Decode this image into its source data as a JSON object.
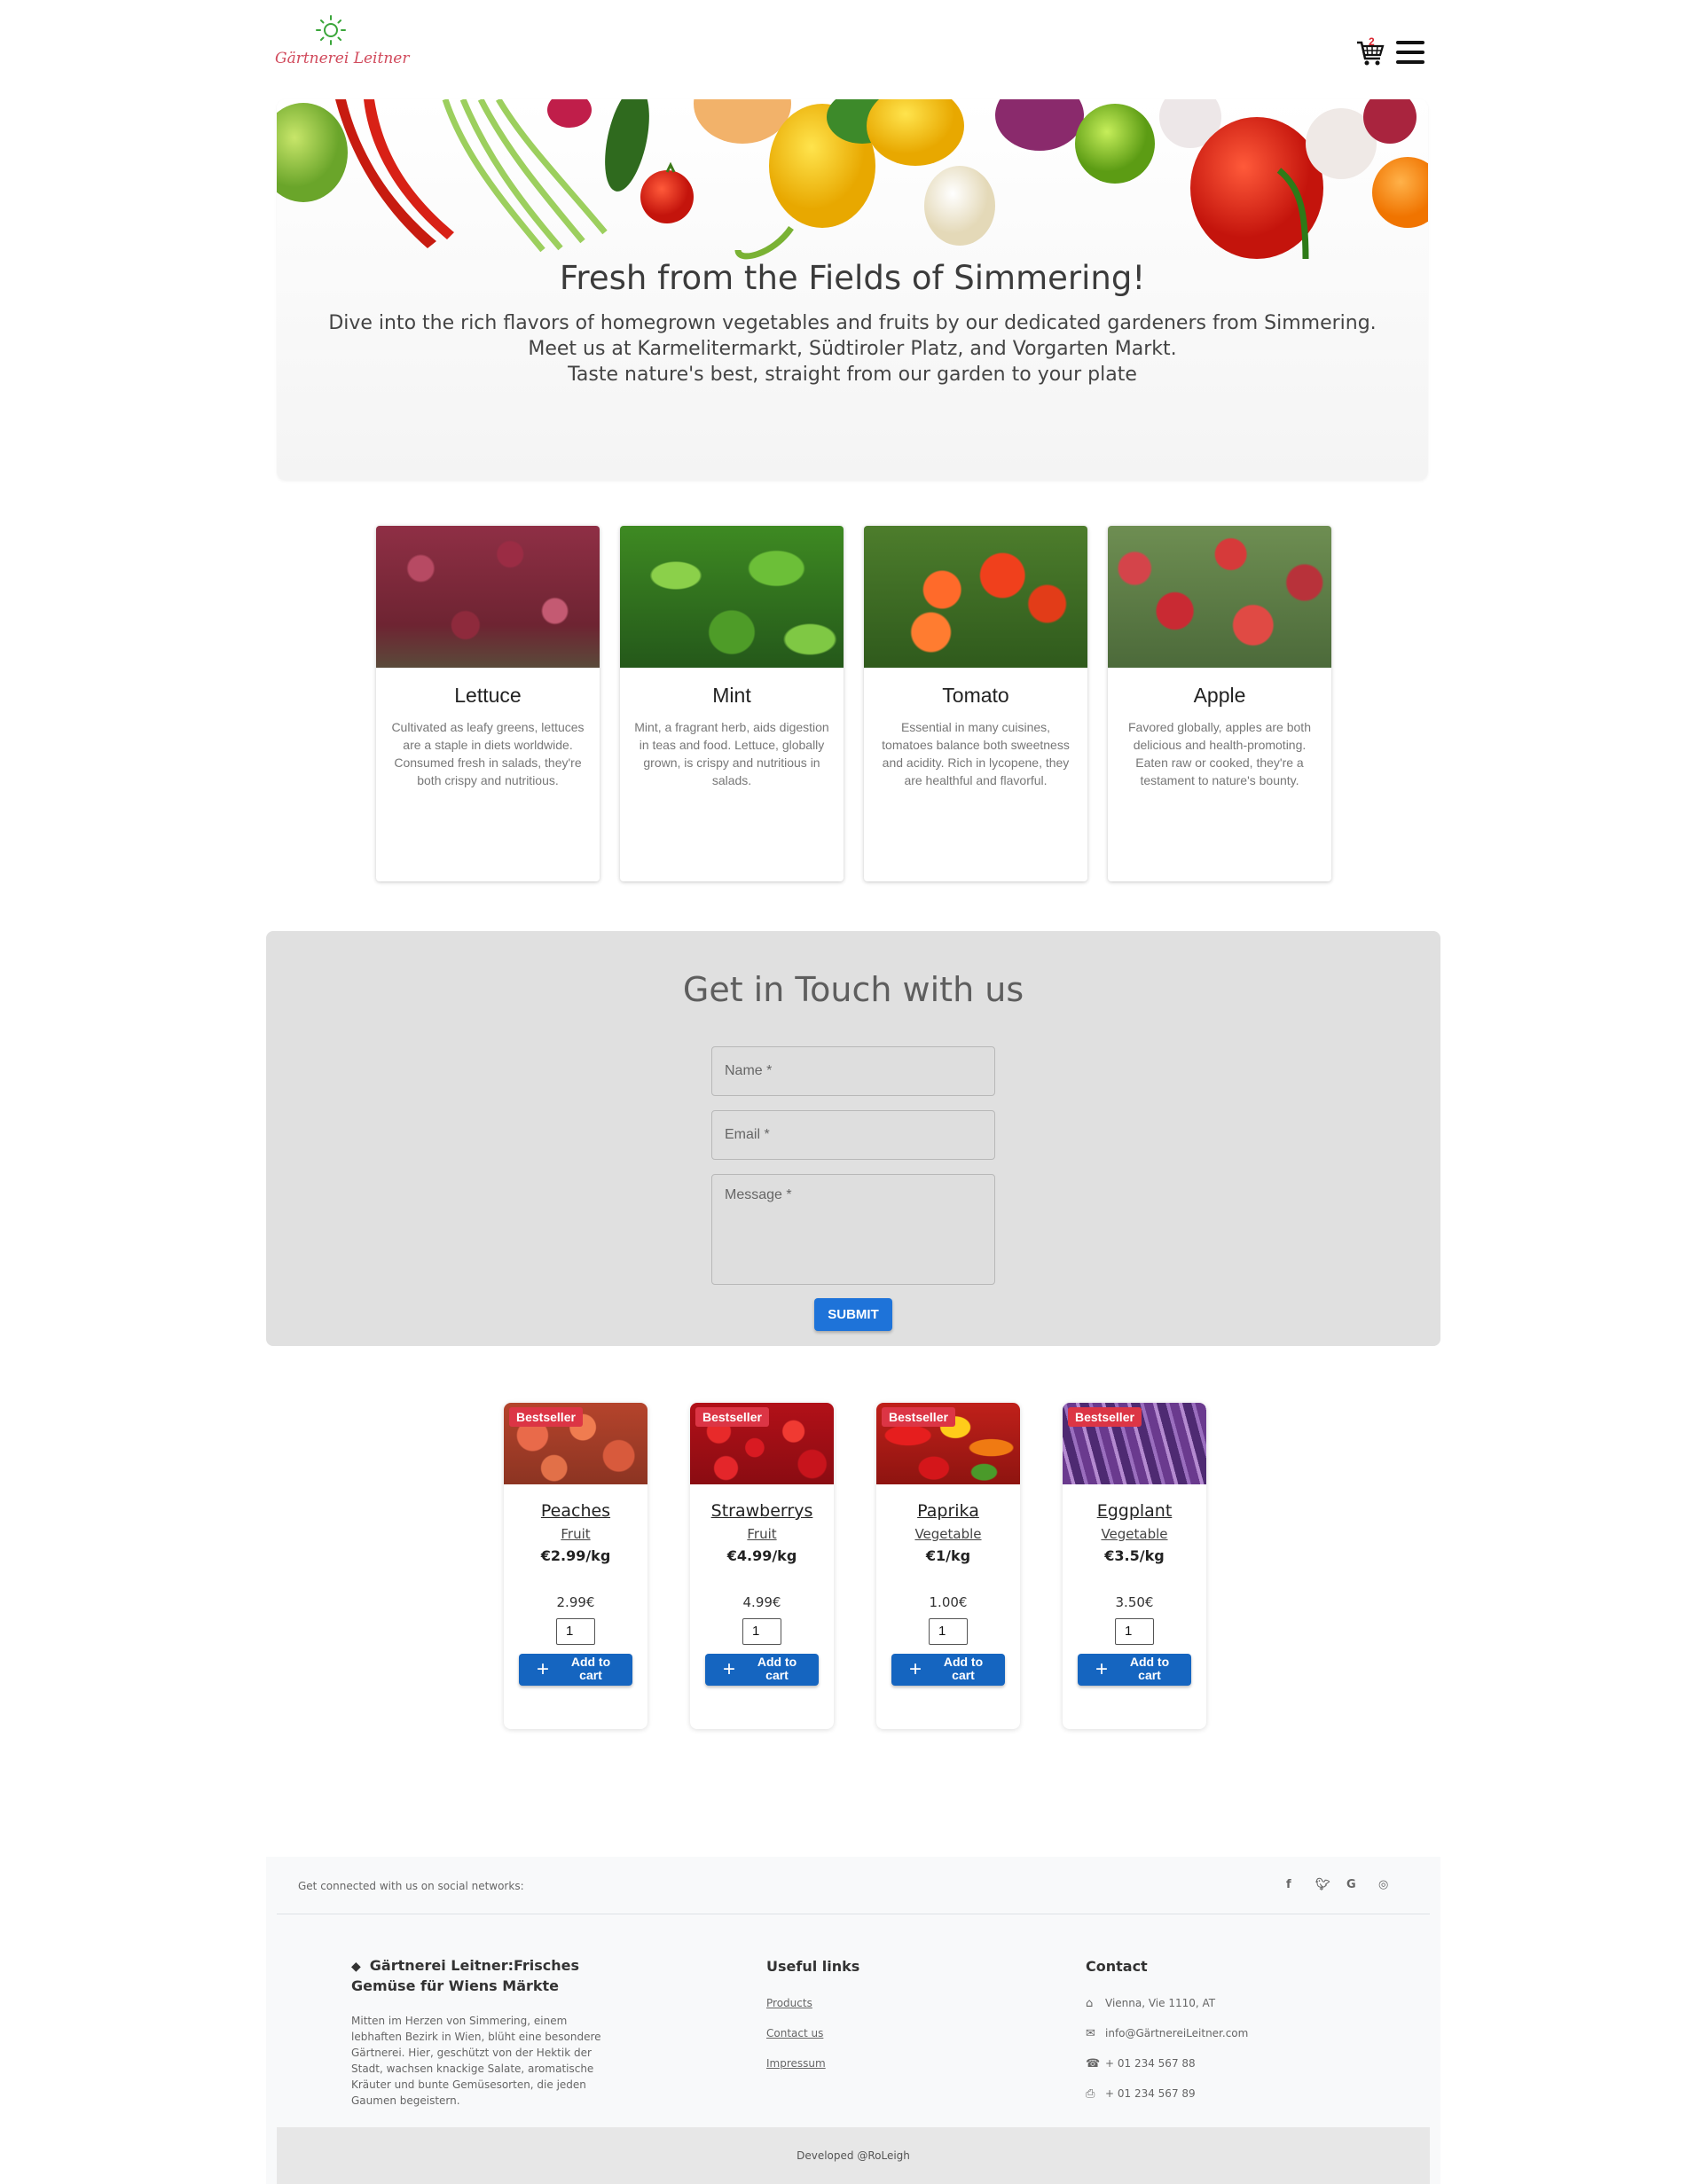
{
  "header": {
    "logo_text": "Gärtnerei Leitner",
    "cart_count": "2",
    "cart_icon": "shopping-cart-icon",
    "menu_icon": "hamburger-menu-icon"
  },
  "hero": {
    "title": "Fresh from the Fields of Simmering!",
    "line1": "Dive into the rich flavors of homegrown vegetables and fruits by our dedicated gardeners from Simmering.",
    "line2": "Meet us at Karmelitermarkt, Südtiroler Platz, and Vorgarten Markt.",
    "line3": "Taste nature's best, straight from our garden to your plate"
  },
  "produce": [
    {
      "title": "Lettuce",
      "desc": "Cultivated as leafy greens, lettuces are a staple in diets worldwide. Consumed fresh in salads, they're both crispy and nutritious."
    },
    {
      "title": "Mint",
      "desc": "Mint, a fragrant herb, aids digestion in teas and food. Lettuce, globally grown, is crispy and nutritious in salads."
    },
    {
      "title": "Tomato",
      "desc": "Essential in many cuisines, tomatoes balance both sweetness and acidity. Rich in lycopene, they are healthful and flavorful."
    },
    {
      "title": "Apple",
      "desc": "Favored globally, apples are both delicious and health-promoting. Eaten raw or cooked, they're a testament to nature's bounty."
    }
  ],
  "contact": {
    "title": "Get in Touch with us",
    "name_placeholder": "Name *",
    "email_placeholder": "Email *",
    "message_placeholder": "Message *",
    "submit_label": "SUBMIT"
  },
  "shop": [
    {
      "badge": "Bestseller",
      "name": "Peaches",
      "category": "Fruit",
      "price_per_kg": "€2.99/kg",
      "price": "2.99€",
      "qty": "1",
      "add_label": "Add to cart"
    },
    {
      "badge": "Bestseller",
      "name": "Strawberrys",
      "category": "Fruit",
      "price_per_kg": "€4.99/kg",
      "price": "4.99€",
      "qty": "1",
      "add_label": "Add to cart"
    },
    {
      "badge": "Bestseller",
      "name": "Paprika",
      "category": "Vegetable",
      "price_per_kg": "€1/kg",
      "price": "1.00€",
      "qty": "1",
      "add_label": "Add to cart"
    },
    {
      "badge": "Bestseller",
      "name": "Eggplant",
      "category": "Vegetable",
      "price_per_kg": "€3.5/kg",
      "price": "3.50€",
      "qty": "1",
      "add_label": "Add to cart"
    }
  ],
  "footer": {
    "social_text": "Get connected with us on social networks:",
    "social_icons": [
      "facebook-icon",
      "twitter-icon",
      "google-icon",
      "instagram-icon"
    ],
    "brand_title": "Gärtnerei Leitner:Frisches Gemüse für Wiens Märkte",
    "brand_desc": "Mitten im Herzen von Simmering, einem lebhaften Bezirk in Wien, blüht eine besondere Gärtnerei. Hier, geschützt von der Hektik der Stadt, wachsen knackige Salate, aromatische Kräuter und bunte Gemüsesorten, die jeden Gaumen begeistern.",
    "links_title": "Useful links",
    "links": [
      "Products",
      "Contact us",
      "Impressum"
    ],
    "contact_title": "Contact",
    "address": "Vienna, Vie 1110, AT",
    "email": "info@GärtnereiLeitner.com",
    "phone": "+ 01 234 567 88",
    "fax": "+ 01 234 567 89",
    "credits": "Developed @RoLeigh"
  }
}
